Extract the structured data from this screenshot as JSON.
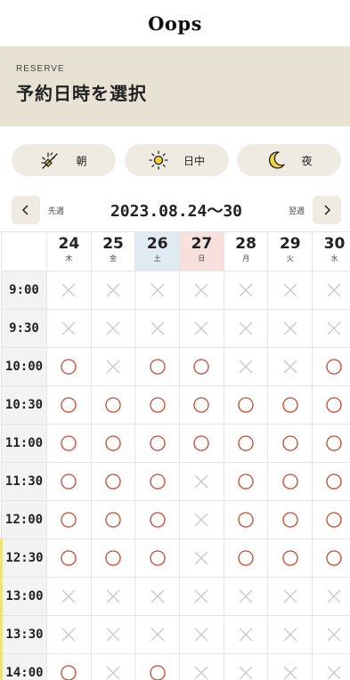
{
  "header": {
    "logo": "Oops"
  },
  "hero": {
    "subtitle": "RESERVE",
    "title": "予約日時を選択"
  },
  "filters": [
    {
      "label": "朝",
      "icon": "sunrise-icon"
    },
    {
      "label": "日中",
      "icon": "sun-icon"
    },
    {
      "label": "夜",
      "icon": "moon-icon"
    }
  ],
  "week_nav": {
    "prev_label": "先週",
    "range": "2023.08.24〜30",
    "next_label": "翌週"
  },
  "days": [
    {
      "num": "24",
      "weekday": "木"
    },
    {
      "num": "25",
      "weekday": "金"
    },
    {
      "num": "26",
      "weekday": "土"
    },
    {
      "num": "27",
      "weekday": "日"
    },
    {
      "num": "28",
      "weekday": "月"
    },
    {
      "num": "29",
      "weekday": "火"
    },
    {
      "num": "30",
      "weekday": "水"
    }
  ],
  "slots": [
    {
      "time": "9:00",
      "avail": [
        0,
        0,
        0,
        0,
        0,
        0,
        0
      ]
    },
    {
      "time": "9:30",
      "avail": [
        0,
        0,
        0,
        0,
        0,
        0,
        0
      ]
    },
    {
      "time": "10:00",
      "avail": [
        1,
        0,
        1,
        1,
        0,
        0,
        1
      ]
    },
    {
      "time": "10:30",
      "avail": [
        1,
        1,
        1,
        1,
        1,
        1,
        1
      ]
    },
    {
      "time": "11:00",
      "avail": [
        1,
        1,
        1,
        1,
        1,
        1,
        1
      ]
    },
    {
      "time": "11:30",
      "avail": [
        1,
        1,
        1,
        0,
        1,
        1,
        1
      ]
    },
    {
      "time": "12:00",
      "avail": [
        1,
        1,
        1,
        0,
        1,
        1,
        1
      ]
    },
    {
      "time": "12:30",
      "avail": [
        1,
        1,
        1,
        0,
        1,
        1,
        1
      ]
    },
    {
      "time": "13:00",
      "avail": [
        0,
        0,
        0,
        0,
        0,
        0,
        0
      ]
    },
    {
      "time": "13:30",
      "avail": [
        0,
        0,
        0,
        0,
        0,
        0,
        0
      ]
    },
    {
      "time": "14:00",
      "avail": [
        1,
        0,
        1,
        0,
        0,
        0,
        0
      ]
    }
  ],
  "colors": {
    "accent": "#c84c32",
    "unavailable": "#c9c9c9",
    "saturday": "#dfeaf3",
    "sunday": "#f8e1dd",
    "hero_bg": "#e8e2d5"
  }
}
